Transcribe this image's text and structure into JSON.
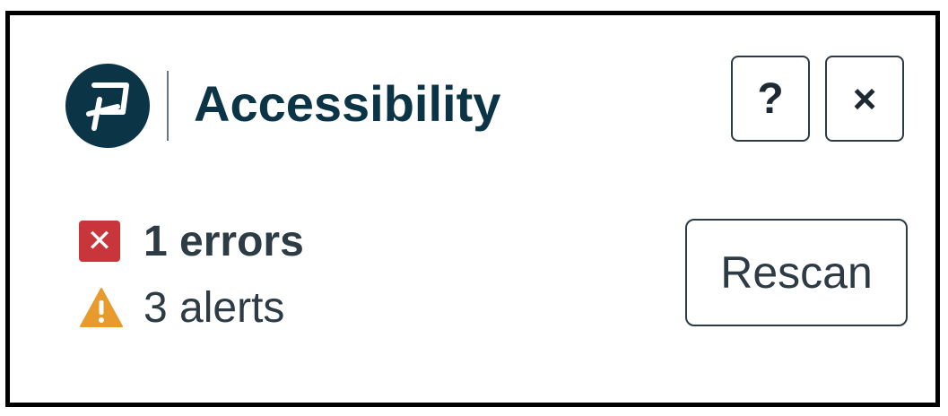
{
  "header": {
    "title": "Accessibility",
    "help_symbol": "?",
    "close_symbol": "×"
  },
  "summary": {
    "errors_label": "1 errors",
    "errors_count": 1,
    "alerts_label": "3 alerts",
    "alerts_count": 3,
    "error_icon_glyph": "✕"
  },
  "actions": {
    "rescan_label": "Rescan"
  },
  "icons": {
    "logo": "brand-logo",
    "help": "question-mark-icon",
    "close": "close-icon",
    "error": "error-x-icon",
    "alert": "warning-triangle-icon"
  },
  "colors": {
    "brand_dark": "#0b3447",
    "text": "#2d3b45",
    "error": "#c8353a",
    "warning": "#e99a2c",
    "border": "#000000"
  }
}
